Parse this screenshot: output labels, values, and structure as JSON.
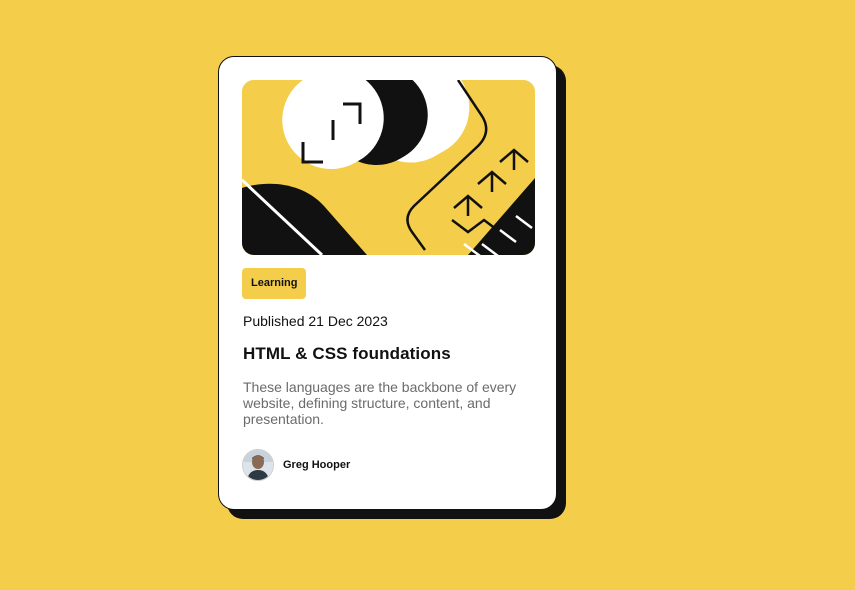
{
  "card": {
    "image_description_icon": "hero-illustration",
    "tag": "Learning",
    "published": "Published 21 Dec 2023",
    "title": "HTML & CSS foundations",
    "excerpt": "These languages are the backbone of every website, defining structure, content, and presentation.",
    "author": {
      "name": "Greg Hooper",
      "avatar_icon": "avatar-portrait"
    }
  },
  "colors": {
    "background": "#F4CE4A",
    "card": "#FFFFFF",
    "ink": "#111111",
    "muted_text": "#6B6B6B"
  }
}
